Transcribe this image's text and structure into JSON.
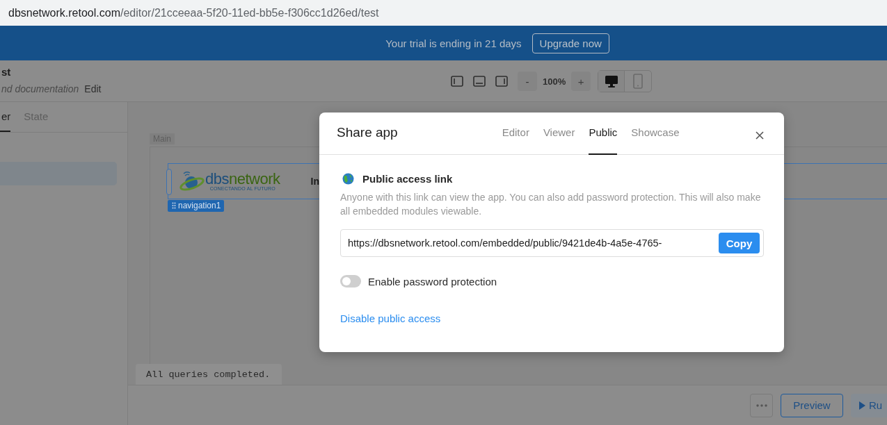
{
  "browser": {
    "url_host": "dbsnetwork.retool.com",
    "url_path": "/editor/21cceeaa-5f20-11ed-bb5e-f306cc1d26ed/test"
  },
  "banner": {
    "message": "Your trial is ending in 21 days",
    "button": "Upgrade now"
  },
  "app_header": {
    "title": "st",
    "description": "nd documentation",
    "edit": "Edit"
  },
  "toolbar": {
    "zoom_out": "-",
    "zoom": "100%",
    "zoom_in": "+",
    "devices": [
      {
        "kind": "desktop",
        "selected": true
      },
      {
        "kind": "mobile",
        "selected": false
      }
    ]
  },
  "left_panel": {
    "tabs": [
      {
        "label": "er",
        "selected": true
      },
      {
        "label": "State",
        "selected": false
      }
    ]
  },
  "canvas": {
    "frame_label": "Main",
    "logo_part_1": "dbs",
    "logo_part_2": "network",
    "logo_tagline": "CONECTANDO AL FUTURO",
    "nav_text": "In",
    "component_tag": "navigation1"
  },
  "console": {
    "message": "All queries completed."
  },
  "footer": {
    "preview": "Preview",
    "run": "Ru"
  },
  "modal": {
    "title": "Share app",
    "tabs": [
      {
        "label": "Editor",
        "selected": false
      },
      {
        "label": "Viewer",
        "selected": false
      },
      {
        "label": "Public",
        "selected": true
      },
      {
        "label": "Showcase",
        "selected": false
      }
    ],
    "section_title": "Public access link",
    "description": "Anyone with this link can view the app. You can also add password protection. This will also make all embedded modules viewable.",
    "link": "https://dbsnetwork.retool.com/embedded/public/9421de4b-4a5e-4765-",
    "copy": "Copy",
    "password_toggle": {
      "label": "Enable password protection",
      "on": false
    },
    "disable_link": "Disable public access"
  }
}
